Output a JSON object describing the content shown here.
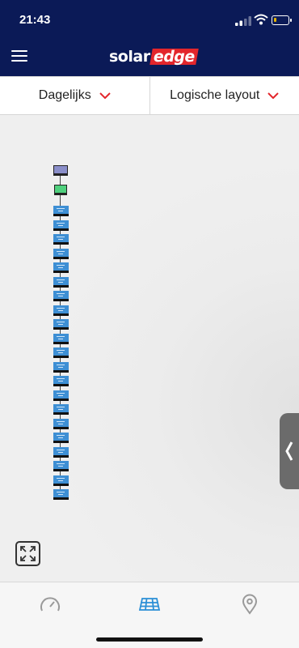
{
  "status_bar": {
    "time": "21:43",
    "battery_level_percent": 10,
    "battery_color": "#e6b400"
  },
  "header": {
    "brand_part1": "solar",
    "brand_part2": "edge",
    "menu_icon": "hamburger-menu-icon",
    "background_color": "#0b1a57",
    "brand_accent_color": "#e3262c"
  },
  "selectors": {
    "period": "Dagelijks",
    "view": "Logische layout",
    "chevron_color": "#e3262c"
  },
  "layout": {
    "inverter_color": "#8a8ec9",
    "optimizer_color": "#4fd07d",
    "panel_color": "#3e8fd4",
    "panel_count": 21
  },
  "controls": {
    "drawer_handle_icon": "chevron-left-icon",
    "fit_screen_icon": "expand-arrows-icon"
  },
  "bottom_nav": {
    "tabs": [
      {
        "icon": "gauge-icon",
        "active": false
      },
      {
        "icon": "solar-panel-icon",
        "active": true
      },
      {
        "icon": "map-pin-icon",
        "active": false
      }
    ],
    "active_color": "#2b8fd6",
    "inactive_color": "#9a9a9a"
  }
}
